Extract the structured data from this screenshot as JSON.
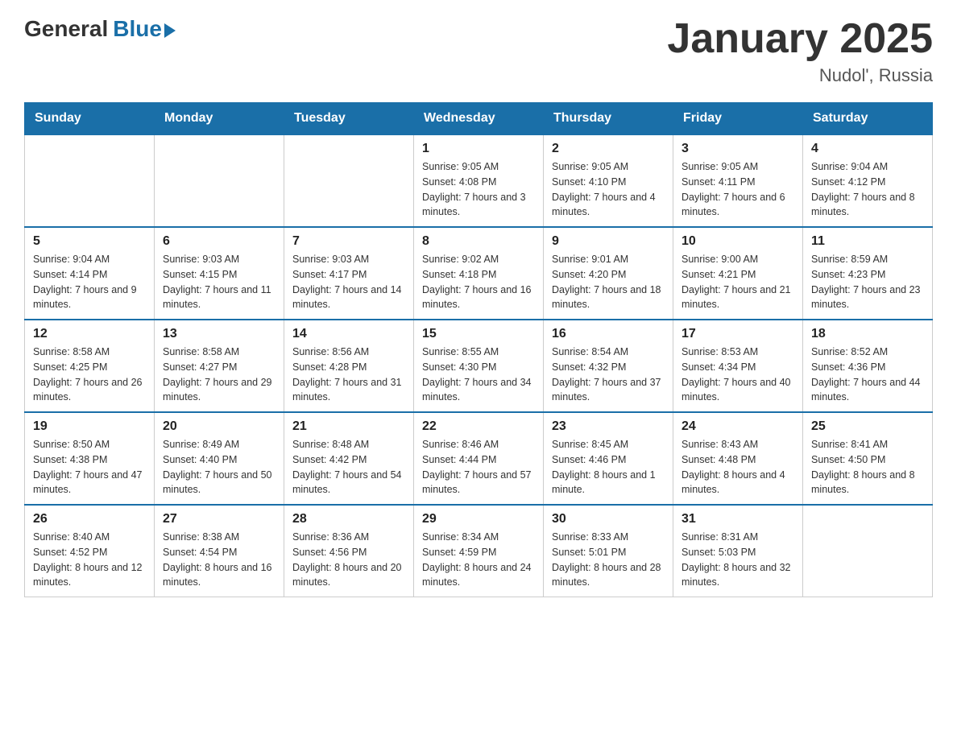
{
  "logo": {
    "general": "General",
    "blue": "Blue"
  },
  "title": "January 2025",
  "location": "Nudol', Russia",
  "days_of_week": [
    "Sunday",
    "Monday",
    "Tuesday",
    "Wednesday",
    "Thursday",
    "Friday",
    "Saturday"
  ],
  "weeks": [
    [
      {
        "day": "",
        "info": ""
      },
      {
        "day": "",
        "info": ""
      },
      {
        "day": "",
        "info": ""
      },
      {
        "day": "1",
        "info": "Sunrise: 9:05 AM\nSunset: 4:08 PM\nDaylight: 7 hours and 3 minutes."
      },
      {
        "day": "2",
        "info": "Sunrise: 9:05 AM\nSunset: 4:10 PM\nDaylight: 7 hours and 4 minutes."
      },
      {
        "day": "3",
        "info": "Sunrise: 9:05 AM\nSunset: 4:11 PM\nDaylight: 7 hours and 6 minutes."
      },
      {
        "day": "4",
        "info": "Sunrise: 9:04 AM\nSunset: 4:12 PM\nDaylight: 7 hours and 8 minutes."
      }
    ],
    [
      {
        "day": "5",
        "info": "Sunrise: 9:04 AM\nSunset: 4:14 PM\nDaylight: 7 hours and 9 minutes."
      },
      {
        "day": "6",
        "info": "Sunrise: 9:03 AM\nSunset: 4:15 PM\nDaylight: 7 hours and 11 minutes."
      },
      {
        "day": "7",
        "info": "Sunrise: 9:03 AM\nSunset: 4:17 PM\nDaylight: 7 hours and 14 minutes."
      },
      {
        "day": "8",
        "info": "Sunrise: 9:02 AM\nSunset: 4:18 PM\nDaylight: 7 hours and 16 minutes."
      },
      {
        "day": "9",
        "info": "Sunrise: 9:01 AM\nSunset: 4:20 PM\nDaylight: 7 hours and 18 minutes."
      },
      {
        "day": "10",
        "info": "Sunrise: 9:00 AM\nSunset: 4:21 PM\nDaylight: 7 hours and 21 minutes."
      },
      {
        "day": "11",
        "info": "Sunrise: 8:59 AM\nSunset: 4:23 PM\nDaylight: 7 hours and 23 minutes."
      }
    ],
    [
      {
        "day": "12",
        "info": "Sunrise: 8:58 AM\nSunset: 4:25 PM\nDaylight: 7 hours and 26 minutes."
      },
      {
        "day": "13",
        "info": "Sunrise: 8:58 AM\nSunset: 4:27 PM\nDaylight: 7 hours and 29 minutes."
      },
      {
        "day": "14",
        "info": "Sunrise: 8:56 AM\nSunset: 4:28 PM\nDaylight: 7 hours and 31 minutes."
      },
      {
        "day": "15",
        "info": "Sunrise: 8:55 AM\nSunset: 4:30 PM\nDaylight: 7 hours and 34 minutes."
      },
      {
        "day": "16",
        "info": "Sunrise: 8:54 AM\nSunset: 4:32 PM\nDaylight: 7 hours and 37 minutes."
      },
      {
        "day": "17",
        "info": "Sunrise: 8:53 AM\nSunset: 4:34 PM\nDaylight: 7 hours and 40 minutes."
      },
      {
        "day": "18",
        "info": "Sunrise: 8:52 AM\nSunset: 4:36 PM\nDaylight: 7 hours and 44 minutes."
      }
    ],
    [
      {
        "day": "19",
        "info": "Sunrise: 8:50 AM\nSunset: 4:38 PM\nDaylight: 7 hours and 47 minutes."
      },
      {
        "day": "20",
        "info": "Sunrise: 8:49 AM\nSunset: 4:40 PM\nDaylight: 7 hours and 50 minutes."
      },
      {
        "day": "21",
        "info": "Sunrise: 8:48 AM\nSunset: 4:42 PM\nDaylight: 7 hours and 54 minutes."
      },
      {
        "day": "22",
        "info": "Sunrise: 8:46 AM\nSunset: 4:44 PM\nDaylight: 7 hours and 57 minutes."
      },
      {
        "day": "23",
        "info": "Sunrise: 8:45 AM\nSunset: 4:46 PM\nDaylight: 8 hours and 1 minute."
      },
      {
        "day": "24",
        "info": "Sunrise: 8:43 AM\nSunset: 4:48 PM\nDaylight: 8 hours and 4 minutes."
      },
      {
        "day": "25",
        "info": "Sunrise: 8:41 AM\nSunset: 4:50 PM\nDaylight: 8 hours and 8 minutes."
      }
    ],
    [
      {
        "day": "26",
        "info": "Sunrise: 8:40 AM\nSunset: 4:52 PM\nDaylight: 8 hours and 12 minutes."
      },
      {
        "day": "27",
        "info": "Sunrise: 8:38 AM\nSunset: 4:54 PM\nDaylight: 8 hours and 16 minutes."
      },
      {
        "day": "28",
        "info": "Sunrise: 8:36 AM\nSunset: 4:56 PM\nDaylight: 8 hours and 20 minutes."
      },
      {
        "day": "29",
        "info": "Sunrise: 8:34 AM\nSunset: 4:59 PM\nDaylight: 8 hours and 24 minutes."
      },
      {
        "day": "30",
        "info": "Sunrise: 8:33 AM\nSunset: 5:01 PM\nDaylight: 8 hours and 28 minutes."
      },
      {
        "day": "31",
        "info": "Sunrise: 8:31 AM\nSunset: 5:03 PM\nDaylight: 8 hours and 32 minutes."
      },
      {
        "day": "",
        "info": ""
      }
    ]
  ]
}
